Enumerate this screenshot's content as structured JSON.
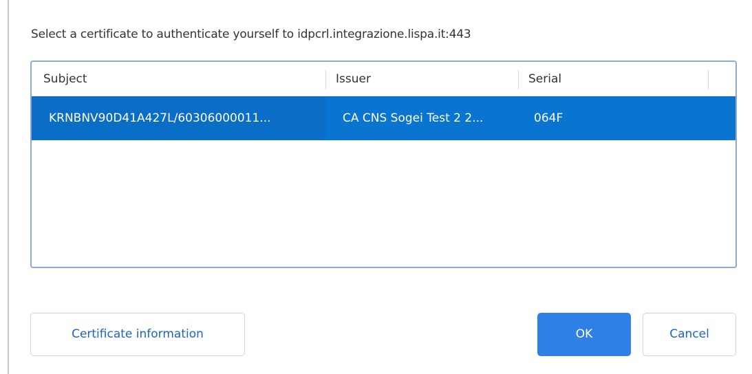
{
  "dialog": {
    "prompt": "Select a certificate to authenticate yourself to idpcrl.integrazione.lispa.it:443"
  },
  "table": {
    "columns": [
      "Subject",
      "Issuer",
      "Serial"
    ],
    "rows": [
      {
        "subject": "KRNBNV90D41A427L/60306000011...",
        "issuer": "CA CNS Sogei Test 2 2...",
        "serial": "064F",
        "selected": true
      }
    ]
  },
  "buttons": {
    "certificate_info": "Certificate information",
    "ok": "OK",
    "cancel": "Cancel"
  },
  "colors": {
    "selection": "#0a74d1",
    "primary_button": "#2f80e6",
    "link_text": "#1a63c8",
    "table_border": "#8aaad4"
  }
}
